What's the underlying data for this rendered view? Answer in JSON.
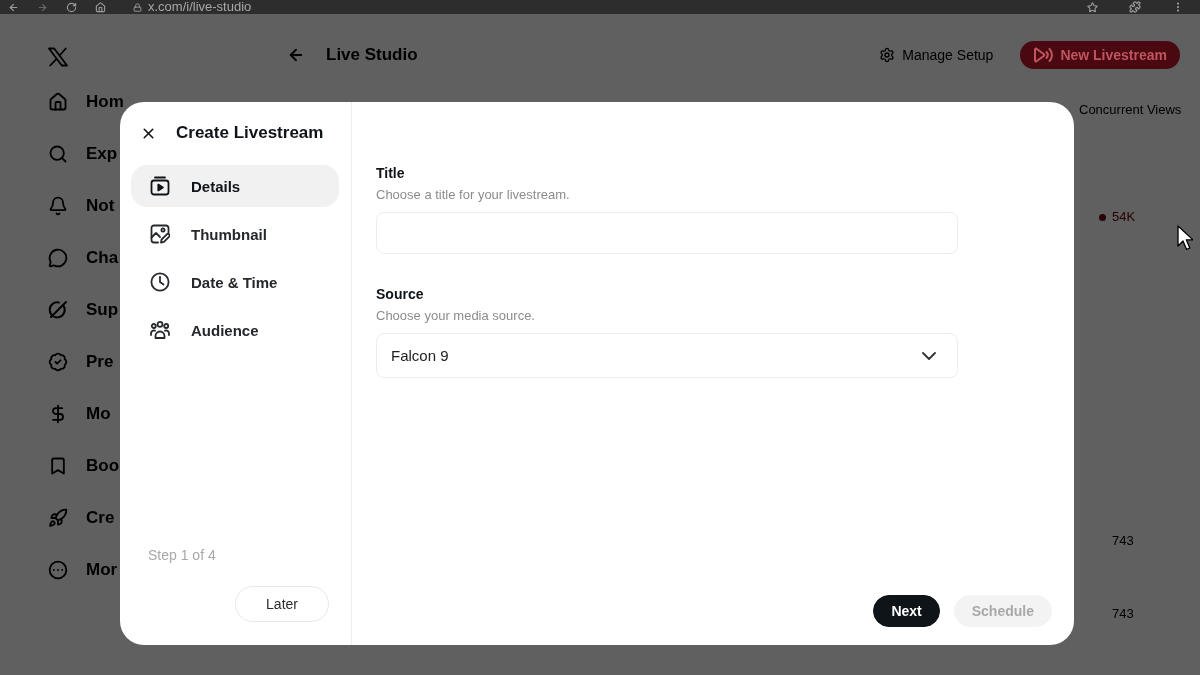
{
  "browser": {
    "url": "x.com/i/live-studio"
  },
  "sidebar": {
    "items": [
      {
        "label": "Hom"
      },
      {
        "label": "Exp"
      },
      {
        "label": "Not"
      },
      {
        "label": "Cha"
      },
      {
        "label": "Sup"
      },
      {
        "label": "Pre"
      },
      {
        "label": "Mo"
      },
      {
        "label": "Boo"
      },
      {
        "label": "Cre"
      },
      {
        "label": "Mor"
      }
    ]
  },
  "header": {
    "title": "Live Studio",
    "actions": [
      {
        "label": "Manage Setup",
        "kind": "link"
      },
      {
        "label": "New Livestream",
        "kind": "primary"
      }
    ]
  },
  "stats": {
    "heading": "Concurrent Views",
    "rows": [
      {
        "value": "54K",
        "live": true
      },
      {
        "value": "743",
        "live": false
      },
      {
        "value": "743",
        "live": false
      }
    ]
  },
  "dialog": {
    "title": "Create Livestream",
    "steps": [
      {
        "label": "Details",
        "selected": true
      },
      {
        "label": "Thumbnail",
        "selected": false
      },
      {
        "label": "Date & Time",
        "selected": false
      },
      {
        "label": "Audience",
        "selected": false
      }
    ],
    "step_counter": "Step 1 of 4",
    "left_actions": [
      {
        "label": "Later",
        "kind": "outline",
        "disabled": false
      }
    ],
    "fields": [
      {
        "kind": "text",
        "label": "Title",
        "hint": "Choose a title for your livestream."
      },
      {
        "kind": "select",
        "label": "Source",
        "hint": "Choose your media source.",
        "value": "Falcon 9"
      }
    ],
    "actions": [
      {
        "label": "Next",
        "kind": "primary",
        "disabled": false
      },
      {
        "label": "Schedule",
        "kind": "secondary",
        "disabled": true
      }
    ]
  }
}
